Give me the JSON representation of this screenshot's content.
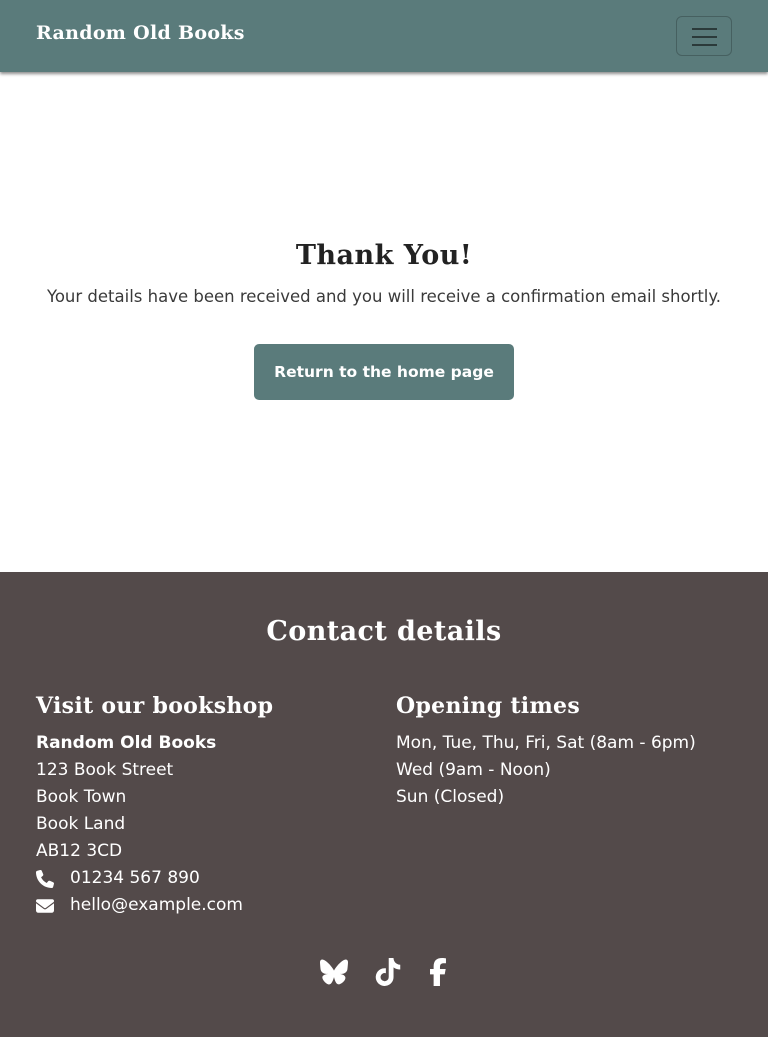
{
  "header": {
    "brand": "Random Old Books",
    "menu_icon": "hamburger-menu-icon"
  },
  "main": {
    "title": "Thank You!",
    "message": "Your details have been received and you will receive a confirmation email shortly.",
    "button_label": "Return to the home page"
  },
  "footer": {
    "title": "Contact details",
    "visit": {
      "heading": "Visit our bookshop",
      "name": "Random Old Books",
      "address": [
        "123 Book Street",
        "Book Town",
        "Book Land",
        "AB12 3CD"
      ],
      "phone": "01234 567 890",
      "email": "hello@example.com",
      "phone_icon": "phone-icon",
      "email_icon": "envelope-icon"
    },
    "opening": {
      "heading": "Opening times",
      "lines": [
        "Mon, Tue, Thu, Fri, Sat (8am - 6pm)",
        "Wed (9am - Noon)",
        "Sun (Closed)"
      ]
    },
    "socials": [
      "bluesky-icon",
      "tiktok-icon",
      "facebook-icon"
    ]
  },
  "colors": {
    "header_bg": "#5a7b7b",
    "button_bg": "#5a7b7b",
    "footer_bg": "#534a4a",
    "text_dark": "#222222",
    "text_light": "#ffffff"
  }
}
